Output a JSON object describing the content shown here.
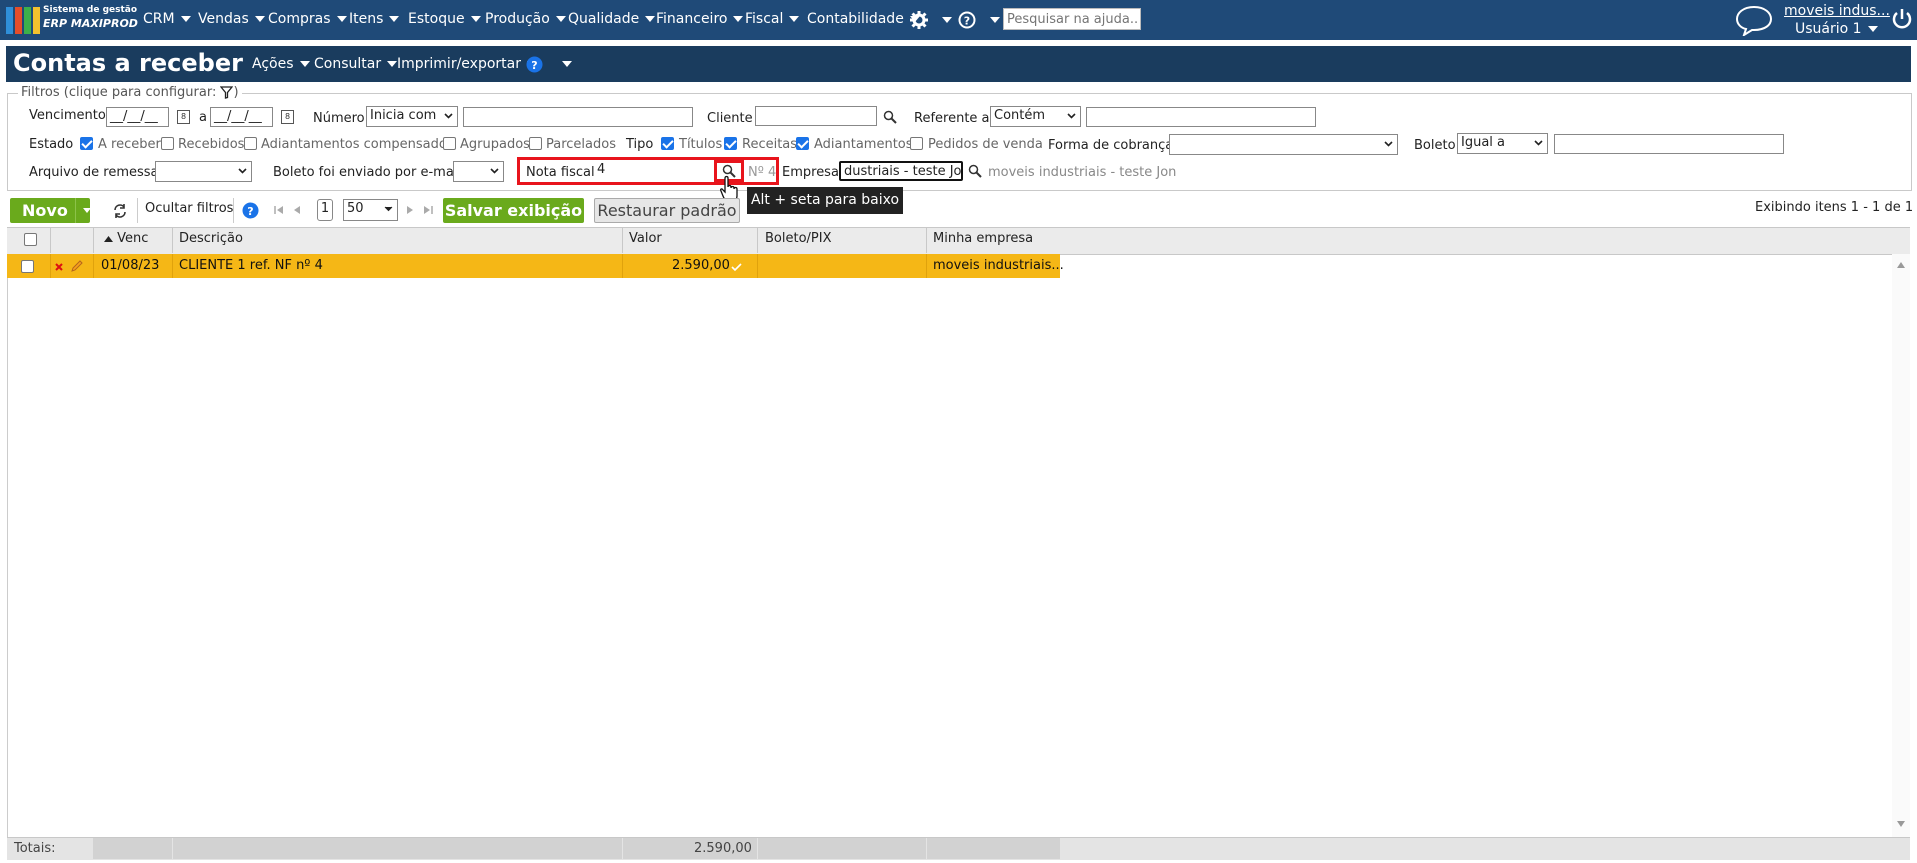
{
  "app": {
    "logo_line1": "Sistema de gestão",
    "logo_line2": "ERP MAXIPROD",
    "menu": [
      "CRM",
      "Vendas",
      "Compras",
      "Itens",
      "Estoque",
      "Produção",
      "Qualidade",
      "Financeiro",
      "Fiscal",
      "Contabilidade"
    ],
    "help_search_placeholder": "Pesquisar na ajuda...",
    "company": "moveis indus...",
    "user": "Usuário 1"
  },
  "page": {
    "title": "Contas a receber",
    "menus": [
      "Ações",
      "Consultar",
      "Imprimir/exportar"
    ]
  },
  "filters": {
    "legend": "Filtros (clique para configurar:",
    "legend_end": ")",
    "vencimento_label": "Vencimento",
    "date_from": "__/__/__",
    "date_sep": "a",
    "date_to": "__/__/__",
    "numero_label": "Número",
    "numero_op": "Inicia com",
    "cliente_label": "Cliente",
    "referente_label": "Referente a",
    "referente_op": "Contém",
    "estado_label": "Estado",
    "estado_options": [
      {
        "label": "A receber",
        "checked": true
      },
      {
        "label": "Recebidos",
        "checked": false
      },
      {
        "label": "Adiantamentos compensados",
        "checked": false
      },
      {
        "label": "Agrupados",
        "checked": false
      },
      {
        "label": "Parcelados",
        "checked": false
      }
    ],
    "tipo_label": "Tipo",
    "tipo_options": [
      {
        "label": "Títulos",
        "checked": true
      },
      {
        "label": "Receitas",
        "checked": true
      },
      {
        "label": "Adiantamentos",
        "checked": true
      },
      {
        "label": "Pedidos de venda",
        "checked": false
      }
    ],
    "forma_cobranca_label": "Forma de cobrança",
    "boleto_label": "Boleto",
    "boleto_op": "Igual a",
    "arquivo_remessa_label": "Arquivo de remessa",
    "boleto_email_label": "Boleto foi enviado por e-mail",
    "nota_fiscal_label": "Nota fiscal",
    "nota_fiscal_value": "4",
    "nota_fiscal_hint": "Nº 4",
    "empresa_label": "Empresa",
    "empresa_value": "dustriais - teste Jon",
    "empresa_hint": "moveis industriais - teste Jon"
  },
  "toolbar": {
    "new_label": "Novo",
    "hide_filters": "Ocultar filtros",
    "page_number": "1",
    "page_size": "50",
    "save_view": "Salvar exibição",
    "restore_default": "Restaurar padrão",
    "tooltip": "Alt + seta para baixo",
    "showing": "Exibindo itens 1 - 1 de 1"
  },
  "grid": {
    "columns": [
      "Venc",
      "Descrição",
      "Valor",
      "Boleto/PIX",
      "Minha empresa"
    ],
    "rows": [
      {
        "venc": "01/08/23",
        "descricao": "CLIENTE 1 ref. NF nº 4",
        "valor": "2.590,00",
        "boleto": "",
        "empresa": "moveis industriais..."
      }
    ],
    "totals_label": "Totais:",
    "totals_valor": "2.590,00"
  },
  "colors": {
    "topbar": "#1f4a78",
    "titlebar": "#1a3c5e",
    "green": "#6aaa1c",
    "row_highlight": "#f5b716",
    "highlight_box": "#e8141c",
    "checkbox": "#1a73e8"
  }
}
